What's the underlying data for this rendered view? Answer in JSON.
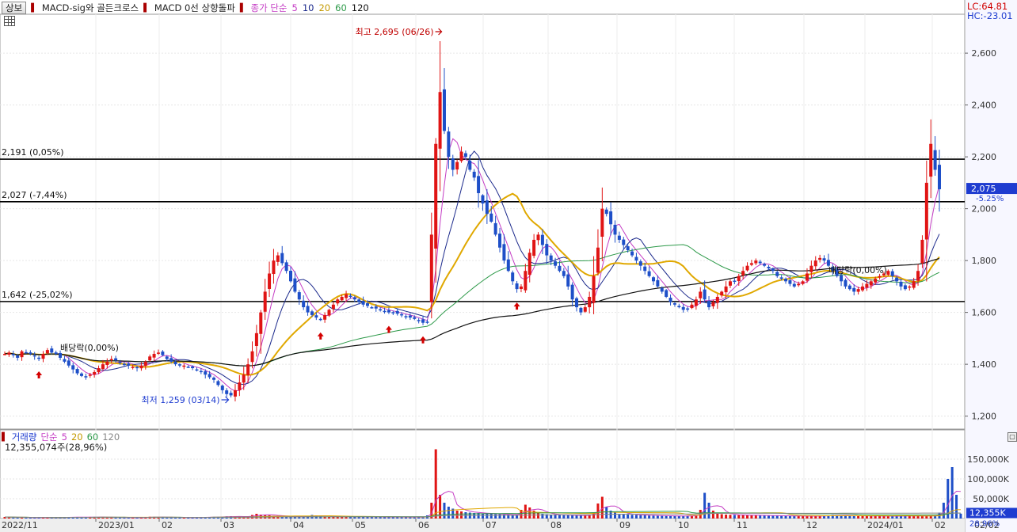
{
  "toolbar": {
    "tab_label": "상보",
    "indicator_1": "MACD-sig와 골든크로스",
    "indicator_2": "MACD 0선 상향돌파",
    "ma_label": "종가 단순",
    "periods": [
      "5",
      "10",
      "20",
      "60",
      "120"
    ],
    "grid_icon": "grid-icon"
  },
  "colors": {
    "up": "#e01414",
    "down": "#1e4fc8",
    "ma5": "#c43cc4",
    "ma10": "#1c2a8c",
    "ma20": "#e0a800",
    "ma60": "#2e9a4a",
    "ma120": "#111111",
    "arrow": "#d40000",
    "marker": "#1e3cd0"
  },
  "side_panel": {
    "lc": "LC:64.81",
    "hc": "HC:-23.01",
    "price": "2,075",
    "price_change": "-5.25%"
  },
  "volume_panel": {
    "title": "거래량",
    "ma_label": "단순",
    "periods": [
      "5",
      "20",
      "60",
      "120"
    ],
    "summary": "12,355,074주(28,96%)",
    "current_value": "12,355K",
    "current_pct": "28.96%",
    "ticks": [
      "150,000K",
      "100,000K",
      "50,000K"
    ]
  },
  "chart_data": {
    "type": "candlestick",
    "price_axis": {
      "ticks": [
        "2,600",
        "2,400",
        "2,200",
        "2,000",
        "1,800",
        "1,600",
        "1,400",
        "1,200"
      ],
      "range": [
        1150,
        2750
      ]
    },
    "x_axis": {
      "labels": [
        "2022/11",
        "2023/01",
        "02",
        "03",
        "04",
        "05",
        "06",
        "07",
        "08",
        "09",
        "10",
        "11",
        "12",
        "2024/01",
        "02",
        "02/02"
      ]
    },
    "reference_lines": [
      {
        "value": 2191,
        "label": "2,191 (0,05%)"
      },
      {
        "value": 2027,
        "label": "2,027 (-7,44%)"
      },
      {
        "value": 1642,
        "label": "1,642 (-25,02%)"
      }
    ],
    "annotations": {
      "high": "최고 2,695 (06/26)",
      "low": "최저 1,259 (03/14)",
      "dividend_1": "배당락(0,00%)",
      "dividend_2": "배당락(0,00%)"
    },
    "closes": [
      1440,
      1445,
      1435,
      1425,
      1450,
      1445,
      1440,
      1430,
      1425,
      1440,
      1455,
      1445,
      1440,
      1425,
      1410,
      1395,
      1380,
      1365,
      1355,
      1350,
      1360,
      1370,
      1385,
      1400,
      1410,
      1420,
      1415,
      1405,
      1400,
      1395,
      1390,
      1385,
      1395,
      1410,
      1430,
      1440,
      1445,
      1435,
      1420,
      1410,
      1400,
      1395,
      1395,
      1390,
      1385,
      1380,
      1370,
      1360,
      1350,
      1340,
      1320,
      1300,
      1285,
      1280,
      1300,
      1330,
      1360,
      1400,
      1450,
      1520,
      1600,
      1680,
      1750,
      1800,
      1820,
      1790,
      1760,
      1720,
      1680,
      1650,
      1620,
      1600,
      1590,
      1580,
      1575,
      1590,
      1610,
      1630,
      1650,
      1660,
      1670,
      1660,
      1650,
      1640,
      1630,
      1625,
      1620,
      1615,
      1610,
      1605,
      1600,
      1600,
      1595,
      1590,
      1585,
      1580,
      1575,
      1570,
      1560,
      1560,
      1900,
      2250,
      2450,
      2300,
      2200,
      2150,
      2180,
      2220,
      2200,
      2150,
      2120,
      2060,
      2020,
      1980,
      1950,
      1900,
      1850,
      1800,
      1760,
      1720,
      1690,
      1700,
      1760,
      1830,
      1880,
      1900,
      1860,
      1820,
      1800,
      1780,
      1760,
      1740,
      1700,
      1650,
      1620,
      1600,
      1620,
      1660,
      1740,
      1850,
      2000,
      1980,
      1940,
      1900,
      1880,
      1860,
      1840,
      1820,
      1800,
      1780,
      1760,
      1740,
      1720,
      1700,
      1680,
      1660,
      1640,
      1630,
      1620,
      1610,
      1615,
      1630,
      1650,
      1680,
      1650,
      1620,
      1640,
      1660,
      1680,
      1700,
      1720,
      1720,
      1740,
      1760,
      1780,
      1790,
      1800,
      1790,
      1780,
      1770,
      1760,
      1740,
      1730,
      1720,
      1710,
      1700,
      1710,
      1720,
      1750,
      1780,
      1800,
      1810,
      1800,
      1780,
      1760,
      1740,
      1720,
      1700,
      1690,
      1680,
      1690,
      1700,
      1710,
      1720,
      1730,
      1740,
      1750,
      1760,
      1740,
      1720,
      1700,
      1690,
      1700,
      1720,
      1760,
      1880,
      2100,
      2250,
      2150,
      2075
    ],
    "volumes": [
      4000,
      3500,
      3000,
      2500,
      3000,
      2800,
      2500,
      2400,
      2600,
      3000,
      2800,
      2500,
      2300,
      2600,
      3200,
      4000,
      3800,
      3500,
      3200,
      3600,
      4200,
      3800,
      3500,
      3400,
      3200,
      3000,
      2800,
      2700,
      2600,
      2500,
      2600,
      2700,
      2800,
      3200,
      4500,
      4000,
      3600,
      3200,
      3000,
      2900,
      2800,
      2700,
      2600,
      2500,
      2700,
      3000,
      3200,
      3400,
      3600,
      3800,
      4200,
      4800,
      5500,
      6000,
      5000,
      4500,
      4000,
      6000,
      9000,
      12000,
      10000,
      9000,
      8000,
      7000,
      6500,
      6000,
      5500,
      5000,
      4800,
      4600,
      5000,
      7000,
      9000,
      8000,
      6000,
      5500,
      5000,
      4800,
      4600,
      4500,
      4400,
      4300,
      4200,
      4100,
      4000,
      4000,
      3900,
      3900,
      3800,
      3800,
      3800,
      3700,
      3700,
      3600,
      3600,
      3600,
      3500,
      3500,
      4000,
      8000,
      40000,
      175000,
      60000,
      40000,
      30000,
      25000,
      20000,
      18000,
      16000,
      15000,
      14000,
      14000,
      13000,
      12000,
      12000,
      11000,
      11000,
      10000,
      10000,
      9500,
      9000,
      22000,
      35000,
      28000,
      20000,
      15000,
      12000,
      11000,
      10000,
      9500,
      9000,
      8500,
      8000,
      8000,
      7800,
      7500,
      8000,
      10000,
      15000,
      38000,
      55000,
      30000,
      20000,
      15000,
      12000,
      11000,
      10000,
      9500,
      9000,
      8500,
      8000,
      7800,
      7500,
      7200,
      7000,
      6800,
      6600,
      6400,
      6200,
      6000,
      6500,
      7000,
      9000,
      22000,
      65000,
      40000,
      20000,
      14000,
      11000,
      10000,
      9500,
      9000,
      8800,
      8600,
      8400,
      8200,
      8000,
      7800,
      7600,
      7400,
      7200,
      7000,
      6800,
      6600,
      6500,
      6400,
      6300,
      6200,
      6100,
      6000,
      6200,
      6500,
      7000,
      8000,
      9000,
      8500,
      8000,
      7500,
      7200,
      7000,
      6800,
      6600,
      6500,
      6400,
      6300,
      6200,
      6100,
      6000,
      6000,
      6200,
      6400,
      6600,
      6800,
      7000,
      6800,
      6600,
      6500,
      7000,
      8000,
      15000,
      40000,
      100000,
      130000,
      60000,
      12355
    ]
  }
}
